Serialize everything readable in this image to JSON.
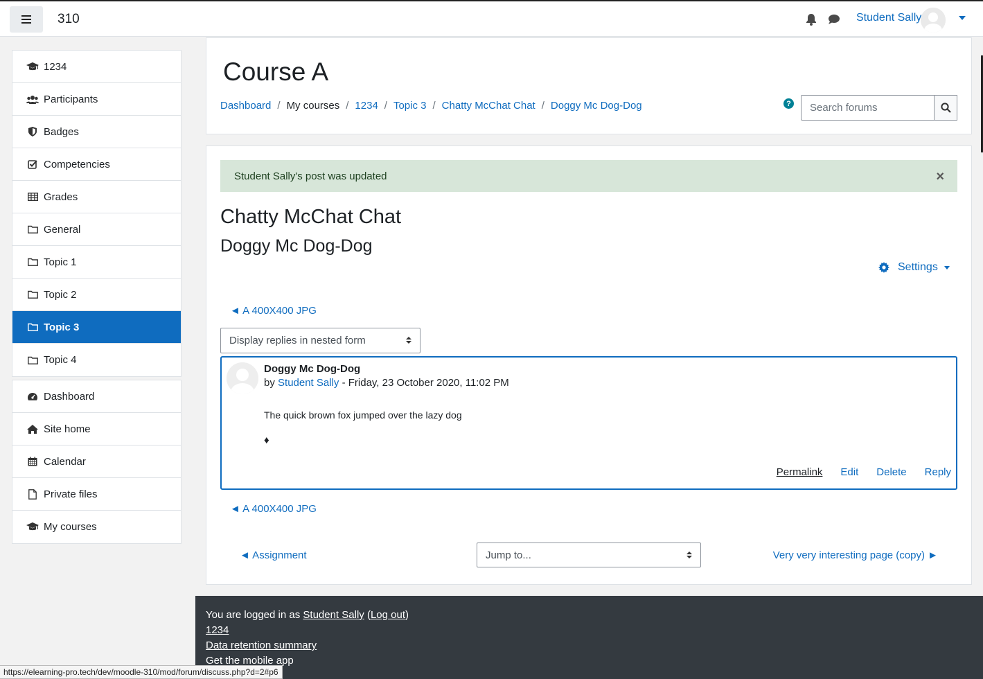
{
  "navbar": {
    "site_name": "310",
    "user_name": "Student Sally"
  },
  "drawer": {
    "course_items": [
      {
        "label": "1234",
        "icon": "graduation-cap-icon"
      },
      {
        "label": "Participants",
        "icon": "users-icon"
      },
      {
        "label": "Badges",
        "icon": "shield-icon"
      },
      {
        "label": "Competencies",
        "icon": "check-square-icon"
      },
      {
        "label": "Grades",
        "icon": "table-icon"
      },
      {
        "label": "General",
        "icon": "folder-icon"
      },
      {
        "label": "Topic 1",
        "icon": "folder-icon"
      },
      {
        "label": "Topic 2",
        "icon": "folder-icon"
      },
      {
        "label": "Topic 3",
        "icon": "folder-icon",
        "active": true
      },
      {
        "label": "Topic 4",
        "icon": "folder-icon"
      }
    ],
    "site_items": [
      {
        "label": "Dashboard",
        "icon": "tachometer-icon"
      },
      {
        "label": "Site home",
        "icon": "home-icon"
      },
      {
        "label": "Calendar",
        "icon": "calendar-icon"
      },
      {
        "label": "Private files",
        "icon": "file-icon"
      },
      {
        "label": "My courses",
        "icon": "graduation-cap-icon"
      }
    ]
  },
  "header": {
    "course_title": "Course A",
    "breadcrumb": [
      "Dashboard",
      "My courses",
      "1234",
      "Topic 3",
      "Chatty McChat Chat",
      "Doggy Mc Dog-Dog"
    ],
    "search_placeholder": "Search forums"
  },
  "main": {
    "alert_text": "Student Sally's post was updated",
    "forum_title": "Chatty McChat Chat",
    "discussion_title": "Doggy Mc Dog-Dog",
    "settings_label": "Settings",
    "prev_discussion": "◄ A 400X400 JPG",
    "display_mode": "Display replies in nested form",
    "post": {
      "subject": "Doggy Mc Dog-Dog",
      "by_prefix": "by",
      "author": "Student Sally",
      "date": " - Friday, 23 October 2020, 11:02 PM",
      "message": "The quick brown fox jumped over the lazy dog",
      "symbol": "♦",
      "actions": [
        "Permalink",
        "Edit",
        "Delete",
        "Reply"
      ]
    },
    "prev_activity": "◄ Assignment",
    "jump_to": "Jump to...",
    "next_activity": "Very very interesting page (copy) ►"
  },
  "footer": {
    "logged_in_prefix": "You are logged in as ",
    "logged_in_user": "Student Sally",
    "logout": "Log out",
    "course_link": "1234",
    "data_retention": "Data retention summary",
    "mobile_app": "Get the mobile app"
  },
  "status_bar_url": "https://elearning-pro.tech/dev/moodle-310/mod/forum/discuss.php?d=2#p6"
}
